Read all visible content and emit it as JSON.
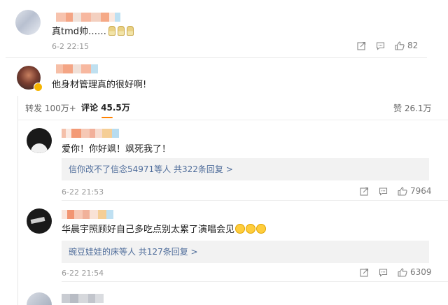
{
  "top_comment": {
    "text": "真tmd帅……",
    "time": "6-2 22:15",
    "likes": "82",
    "emoji_icons": [
      "doge-emoji-icon",
      "doge-emoji-icon",
      "doge-emoji-icon"
    ]
  },
  "second_comment": {
    "text": "他身材管理真的很好啊!"
  },
  "tabs": {
    "repost": "转发 100万+",
    "comments": "评论 45.5万",
    "likes": "赞 26.1万"
  },
  "comments": [
    {
      "text": "爱你！你好飒！飒死我了！",
      "reply_label": "信你改不了信念54971等人  共322条回复 >",
      "time": "6-22 21:53",
      "likes": "7964"
    },
    {
      "text": "华晨宇照顾好自己多吃点别太累了演唱会见",
      "emoji_icons": [
        "smile-emoji-icon",
        "smile-emoji-icon",
        "smile-emoji-icon"
      ],
      "reply_label": "豌豆娃娃的床等人  共127条回复 >",
      "time": "6-22 21:54",
      "likes": "6309"
    }
  ],
  "colors": {
    "accent": "#ff8200",
    "link": "#4e6c9a",
    "muted": "#999999",
    "reply_bg": "#f2f2f2"
  }
}
